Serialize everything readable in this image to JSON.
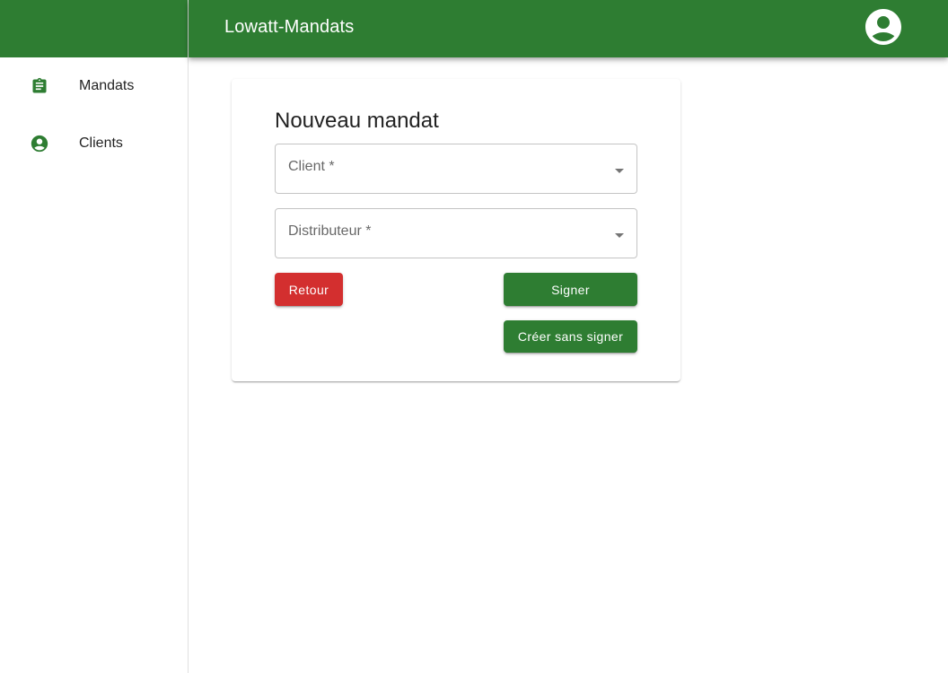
{
  "app": {
    "title": "Lowatt-Mandats",
    "colors": {
      "primary": "#2e7d32",
      "error": "#d32f2f"
    }
  },
  "sidebar": {
    "items": [
      {
        "label": "Mandats",
        "icon": "clipboard-icon"
      },
      {
        "label": "Clients",
        "icon": "account-circle-icon"
      }
    ]
  },
  "header": {
    "account_icon": "account-circle-icon"
  },
  "form": {
    "title": "Nouveau mandat",
    "client_label": "Client *",
    "distributeur_label": "Distributeur *",
    "back_label": "Retour",
    "sign_label": "Signer",
    "create_label": "Créer sans signer"
  }
}
